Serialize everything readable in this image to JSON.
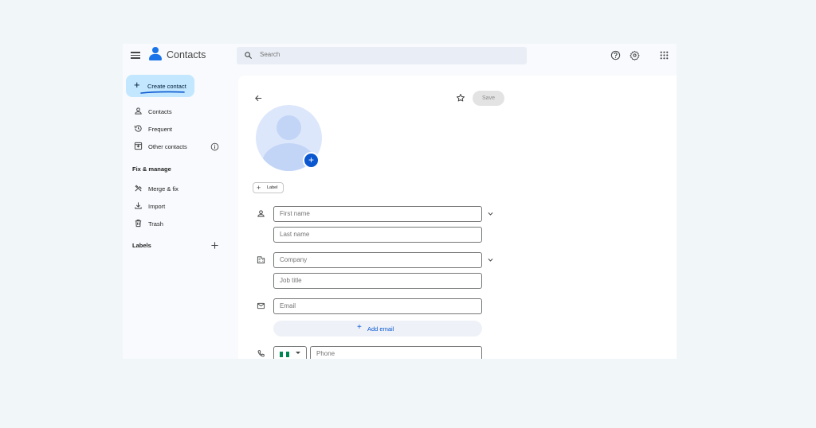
{
  "header": {
    "app_title": "Contacts",
    "search_placeholder": "Search"
  },
  "sidebar": {
    "create_label": "Create contact",
    "items": [
      {
        "label": "Contacts",
        "icon": "person-icon"
      },
      {
        "label": "Frequent",
        "icon": "history-icon"
      },
      {
        "label": "Other contacts",
        "icon": "download-box-icon"
      }
    ],
    "fix_manage_heading": "Fix & manage",
    "fix_items": [
      {
        "label": "Merge & fix",
        "icon": "tools-icon"
      },
      {
        "label": "Import",
        "icon": "import-icon"
      },
      {
        "label": "Trash",
        "icon": "trash-icon"
      }
    ],
    "labels_heading": "Labels"
  },
  "form": {
    "save_label": "Save",
    "label_chip": "Label",
    "first_name_placeholder": "First name",
    "last_name_placeholder": "Last name",
    "company_placeholder": "Company",
    "job_title_placeholder": "Job title",
    "email_placeholder": "Email",
    "add_email_label": "Add email",
    "phone_placeholder": "Phone"
  },
  "colors": {
    "accent": "#0b57d0",
    "create_button_bg": "#c2e7ff",
    "flag_green": "#008751"
  }
}
